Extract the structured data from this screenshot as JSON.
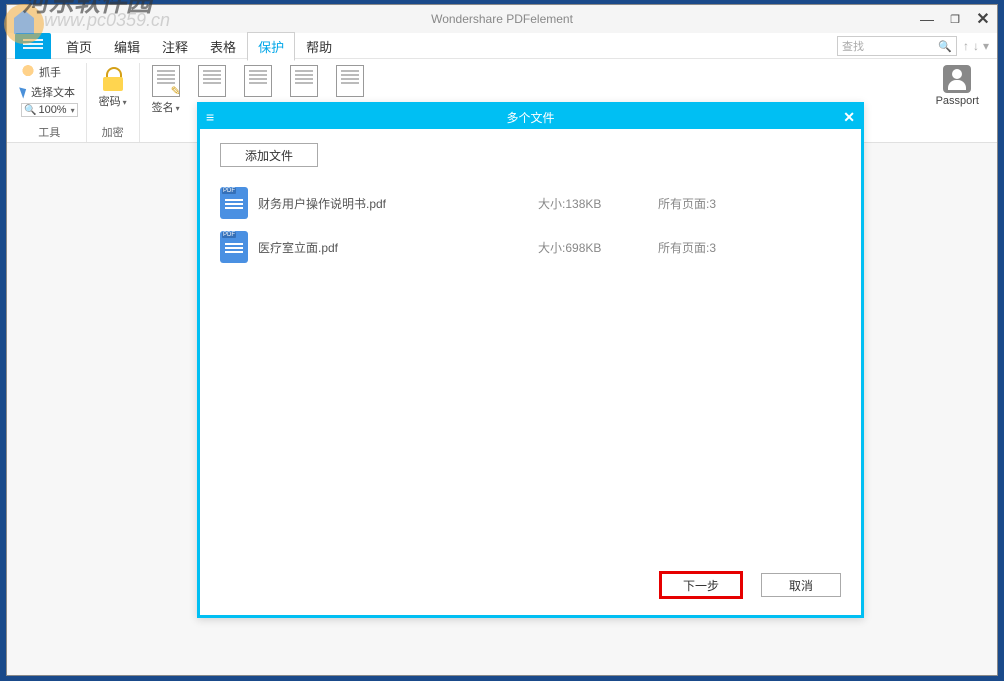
{
  "window": {
    "title": "Wondershare PDFelement"
  },
  "watermark": {
    "text": "河东软件园",
    "url": "www.pc0359.cn"
  },
  "menu": {
    "items": [
      "首页",
      "编辑",
      "注释",
      "表格",
      "保护",
      "帮助"
    ],
    "active_index": 4,
    "search_placeholder": "查找"
  },
  "ribbon": {
    "tools_group_label": "工具",
    "encrypt_group_label": "加密",
    "hand_label": "抓手",
    "select_text_label": "选择文本",
    "zoom_value": "100%",
    "password_label": "密码",
    "sign_label": "签名",
    "passport_label": "Passport"
  },
  "dialog": {
    "title": "多个文件",
    "add_file_label": "添加文件",
    "next_label": "下一步",
    "cancel_label": "取消",
    "size_prefix": "大小:",
    "pages_prefix": "所有页面:",
    "files": [
      {
        "name": "财务用户操作说明书.pdf",
        "size": "138KB",
        "pages": "3"
      },
      {
        "name": "医疗室立面.pdf",
        "size": "698KB",
        "pages": "3"
      }
    ]
  }
}
